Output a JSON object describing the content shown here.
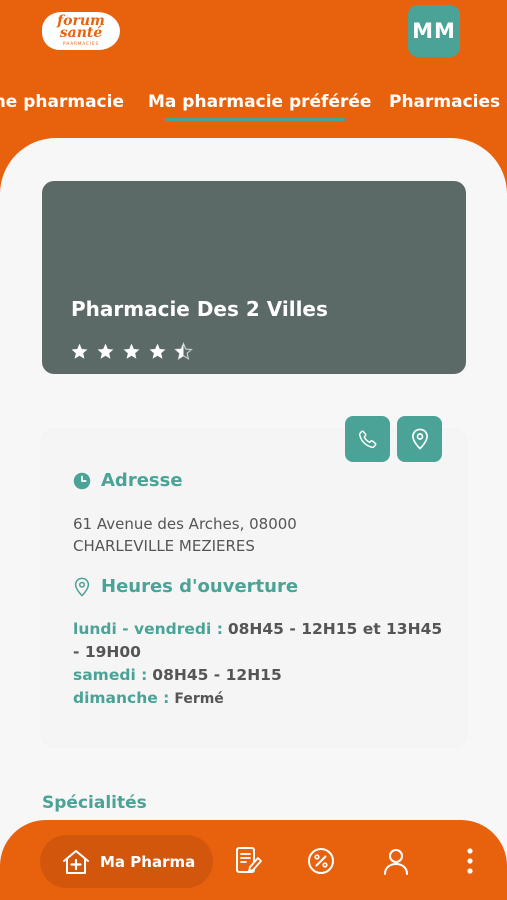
{
  "header": {
    "logo_line1": "forum",
    "logo_line2": "santé",
    "logo_line3": "PHARMACIES",
    "avatar_initials": "MM"
  },
  "tabs": [
    {
      "label": "Une pharmacie"
    },
    {
      "label": "Ma pharmacie préférée",
      "active": true
    },
    {
      "label": "Pharmacies de garde"
    }
  ],
  "pharmacy": {
    "name": "Pharmacie Des 2 Villes",
    "rating": 4.5
  },
  "address": {
    "title": "Adresse",
    "line1": "61 Avenue des Arches, 08000",
    "line2": "CHARLEVILLE MEZIERES"
  },
  "hours": {
    "title": "Heures d'ouverture",
    "rows": [
      {
        "day": "lundi - vendredi :",
        "value": "08H45 - 12H15 et 13H45 - 19H00"
      },
      {
        "day": "samedi :",
        "value": "08H45 - 12H15"
      },
      {
        "day": "dimanche :",
        "value": "Fermé"
      }
    ]
  },
  "specialties_title": "Spécialités",
  "bottom_nav": {
    "active_label": "Ma Pharma"
  },
  "colors": {
    "brand_orange": "#e8620e",
    "accent_teal": "#4aa396",
    "hero_bg": "#5c6a67"
  }
}
